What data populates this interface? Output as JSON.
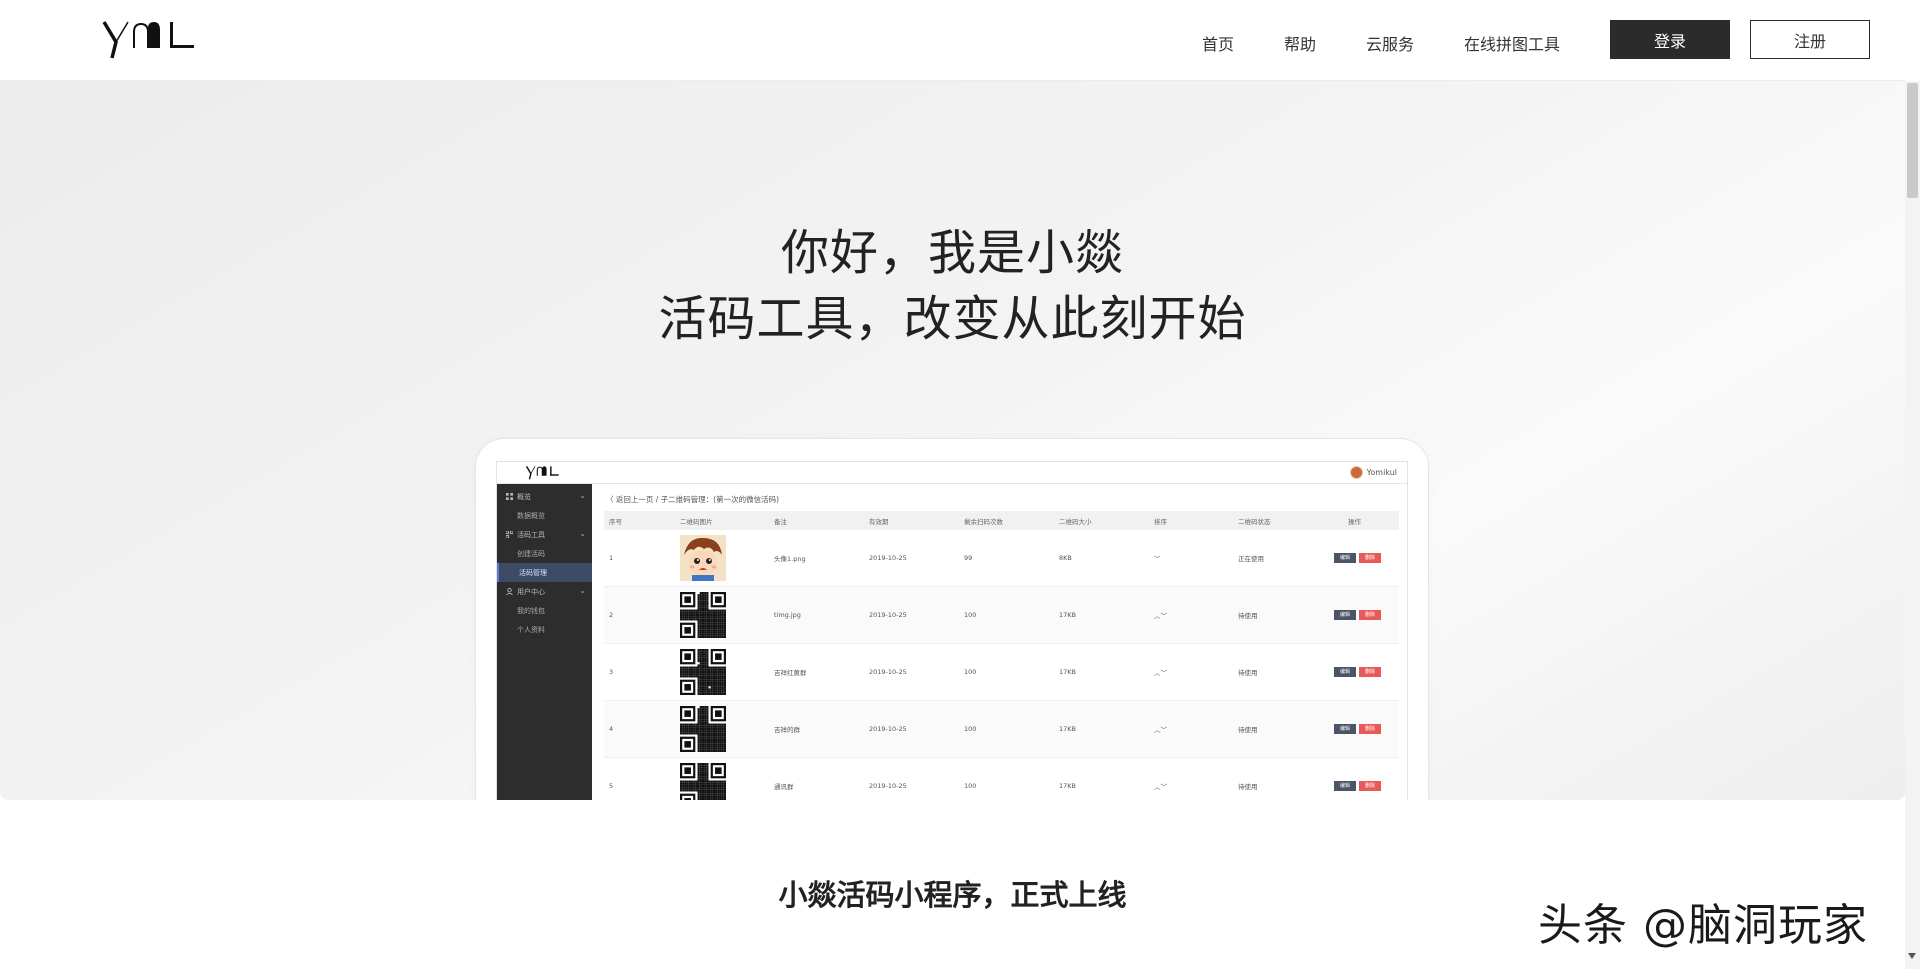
{
  "header": {
    "logo_text": "YML",
    "nav": [
      "首页",
      "帮助",
      "云服务",
      "在线拼图工具"
    ],
    "login_label": "登录",
    "register_label": "注册"
  },
  "hero": {
    "line1": "你好，我是小燚",
    "line2": "活码工具，改变从此刻开始"
  },
  "mock": {
    "logo_text": "YML",
    "username": "Yomikul",
    "sidebar": {
      "overview": "概览",
      "overview_sub": "数据概览",
      "tools": "活码工具",
      "tools_sub": [
        "创建活码",
        "活码管理"
      ],
      "user_center": "用户中心",
      "user_sub": [
        "我的钱包",
        "个人资料"
      ]
    },
    "breadcrumb": "〈 返回上一页 / 子二维码管理：(第一次的微信活码)",
    "columns": [
      "序号",
      "二维码图片",
      "备注",
      "有效期",
      "剩余扫码次数",
      "二维码大小",
      "排序",
      "二维码状态",
      "操作"
    ],
    "rows": [
      {
        "index": "1",
        "note": "头像1.png",
        "expiry": "2019-10-25",
        "remaining": "99",
        "size": "8KB",
        "sort": "﹀",
        "status": "正在使用",
        "image": "avatar"
      },
      {
        "index": "2",
        "note": "timg.jpg",
        "expiry": "2019-10-25",
        "remaining": "100",
        "size": "17KB",
        "sort": "︿﹀",
        "status": "待使用",
        "image": "qr"
      },
      {
        "index": "3",
        "note": "吉祥红黄群",
        "expiry": "2019-10-25",
        "remaining": "100",
        "size": "17KB",
        "sort": "︿﹀",
        "status": "待使用",
        "image": "qr"
      },
      {
        "index": "4",
        "note": "吉祥的群",
        "expiry": "2019-10-25",
        "remaining": "100",
        "size": "17KB",
        "sort": "︿﹀",
        "status": "待使用",
        "image": "qr"
      },
      {
        "index": "5",
        "note": "通讯群",
        "expiry": "2019-10-25",
        "remaining": "100",
        "size": "17KB",
        "sort": "︿﹀",
        "status": "待使用",
        "image": "qr"
      }
    ],
    "edit_label": "编辑",
    "delete_label": "删除"
  },
  "section": {
    "heading": "小燚活码小程序，正式上线"
  },
  "watermark": "头条 @脑洞玩家",
  "colors": {
    "primary_button": "#2b2b2b",
    "sidebar": "#2d2d2d",
    "edit": "#4b5567",
    "delete": "#e85a5a"
  }
}
